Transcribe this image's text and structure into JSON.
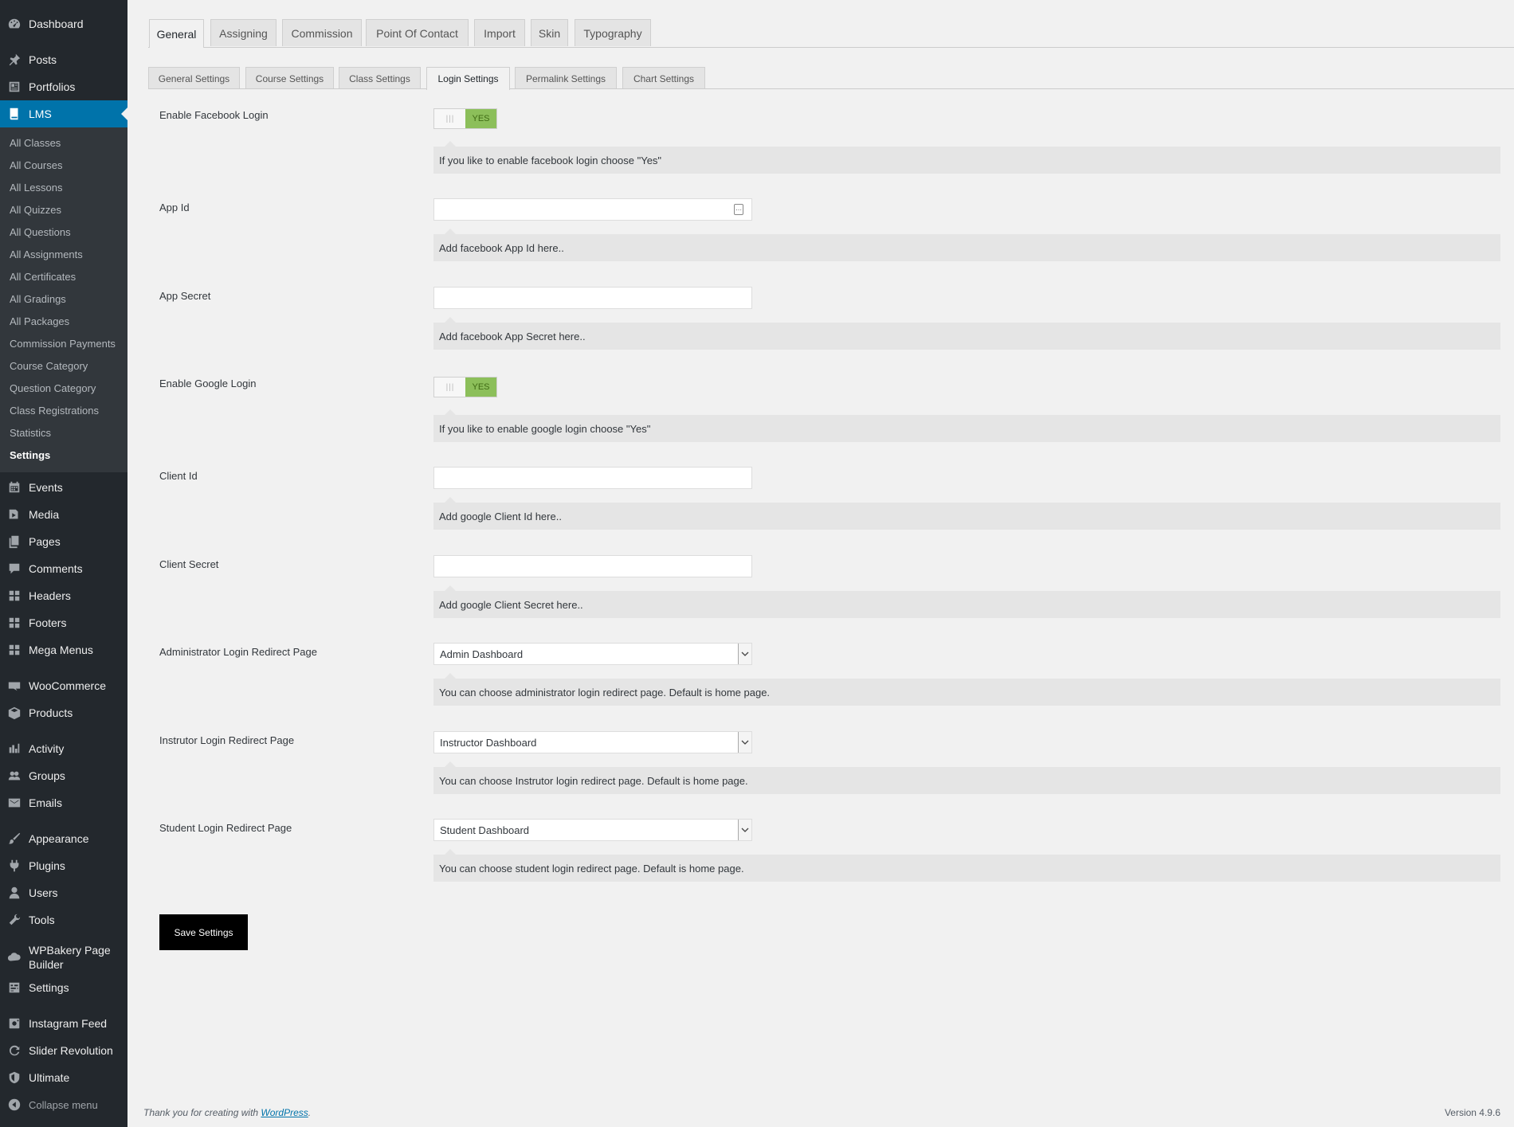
{
  "sidebar": {
    "menu_top": [
      {
        "label": "Dashboard",
        "icon": "dashboard-icon"
      },
      {
        "label": "Posts",
        "icon": "pin-icon"
      },
      {
        "label": "Portfolios",
        "icon": "portfolio-icon"
      },
      {
        "label": "LMS",
        "icon": "book-icon"
      }
    ],
    "lms_submenu": [
      "All Classes",
      "All Courses",
      "All Lessons",
      "All Quizzes",
      "All Questions",
      "All Assignments",
      "All Certificates",
      "All Gradings",
      "All Packages",
      "Commission Payments",
      "Course Category",
      "Question Category",
      "Class Registrations",
      "Statistics",
      "Settings"
    ],
    "menu_bottom": [
      {
        "label": "Events",
        "icon": "calendar-icon"
      },
      {
        "label": "Media",
        "icon": "media-icon"
      },
      {
        "label": "Pages",
        "icon": "pages-icon"
      },
      {
        "label": "Comments",
        "icon": "comment-icon"
      },
      {
        "label": "Headers",
        "icon": "grid-icon"
      },
      {
        "label": "Footers",
        "icon": "grid-icon"
      },
      {
        "label": "Mega Menus",
        "icon": "grid-icon"
      },
      {
        "label": "WooCommerce",
        "icon": "woo-icon"
      },
      {
        "label": "Products",
        "icon": "box-icon"
      },
      {
        "label": "Activity",
        "icon": "activity-icon"
      },
      {
        "label": "Groups",
        "icon": "groups-icon"
      },
      {
        "label": "Emails",
        "icon": "mail-icon"
      },
      {
        "label": "Appearance",
        "icon": "brush-icon"
      },
      {
        "label": "Plugins",
        "icon": "plug-icon"
      },
      {
        "label": "Users",
        "icon": "user-icon"
      },
      {
        "label": "Tools",
        "icon": "wrench-icon"
      },
      {
        "label": "WPBakery Page Builder",
        "icon": "cloud-icon"
      },
      {
        "label": "Settings",
        "icon": "settings-icon"
      },
      {
        "label": "Instagram Feed",
        "icon": "instagram-icon"
      },
      {
        "label": "Slider Revolution",
        "icon": "refresh-icon"
      },
      {
        "label": "Ultimate",
        "icon": "shield-icon"
      },
      {
        "label": "Collapse menu",
        "icon": "collapse-icon"
      }
    ]
  },
  "main_tabs": [
    "General",
    "Assigning",
    "Commission",
    "Point Of Contact",
    "Import",
    "Skin",
    "Typography"
  ],
  "active_main_tab": "General",
  "sub_tabs": [
    "General Settings",
    "Course Settings",
    "Class Settings",
    "Login Settings",
    "Permalink Settings",
    "Chart Settings"
  ],
  "active_sub_tab": "Login Settings",
  "form": {
    "facebook_login": {
      "label": "Enable Facebook Login",
      "toggle_grip": "|||",
      "toggle_state": "YES",
      "description": "If you like to enable facebook login choose \"Yes\""
    },
    "app_id": {
      "label": "App Id",
      "value": "",
      "description": "Add facebook App Id here.."
    },
    "app_secret": {
      "label": "App Secret",
      "value": "",
      "description": "Add facebook App Secret here.."
    },
    "google_login": {
      "label": "Enable Google Login",
      "toggle_grip": "|||",
      "toggle_state": "YES",
      "description": "If you like to enable google login choose \"Yes\""
    },
    "client_id": {
      "label": "Client Id",
      "value": "",
      "description": "Add google Client Id here.."
    },
    "client_secret": {
      "label": "Client Secret",
      "value": "",
      "description": "Add google Client Secret here.."
    },
    "admin_redirect": {
      "label": "Administrator Login Redirect Page",
      "selected": "Admin Dashboard",
      "description": "You can choose administrator login redirect page. Default is home page."
    },
    "instructor_redirect": {
      "label": "Instrutor Login Redirect Page",
      "selected": "Instructor Dashboard",
      "description": "You can choose Instrutor login redirect page. Default is home page."
    },
    "student_redirect": {
      "label": "Student Login Redirect Page",
      "selected": "Student Dashboard",
      "description": "You can choose student login redirect page. Default is home page."
    }
  },
  "save_button": "Save Settings",
  "footer": {
    "thanks_prefix": "Thank you for creating with ",
    "thanks_link": "WordPress",
    "thanks_suffix": ".",
    "version": "Version 4.9.6"
  },
  "colors": {
    "sidebar_bg": "#23282d",
    "submenu_bg": "#32373c",
    "accent": "#0073aa",
    "toggle_on": "#8cbf5a",
    "page_bg": "#f1f1f1"
  }
}
